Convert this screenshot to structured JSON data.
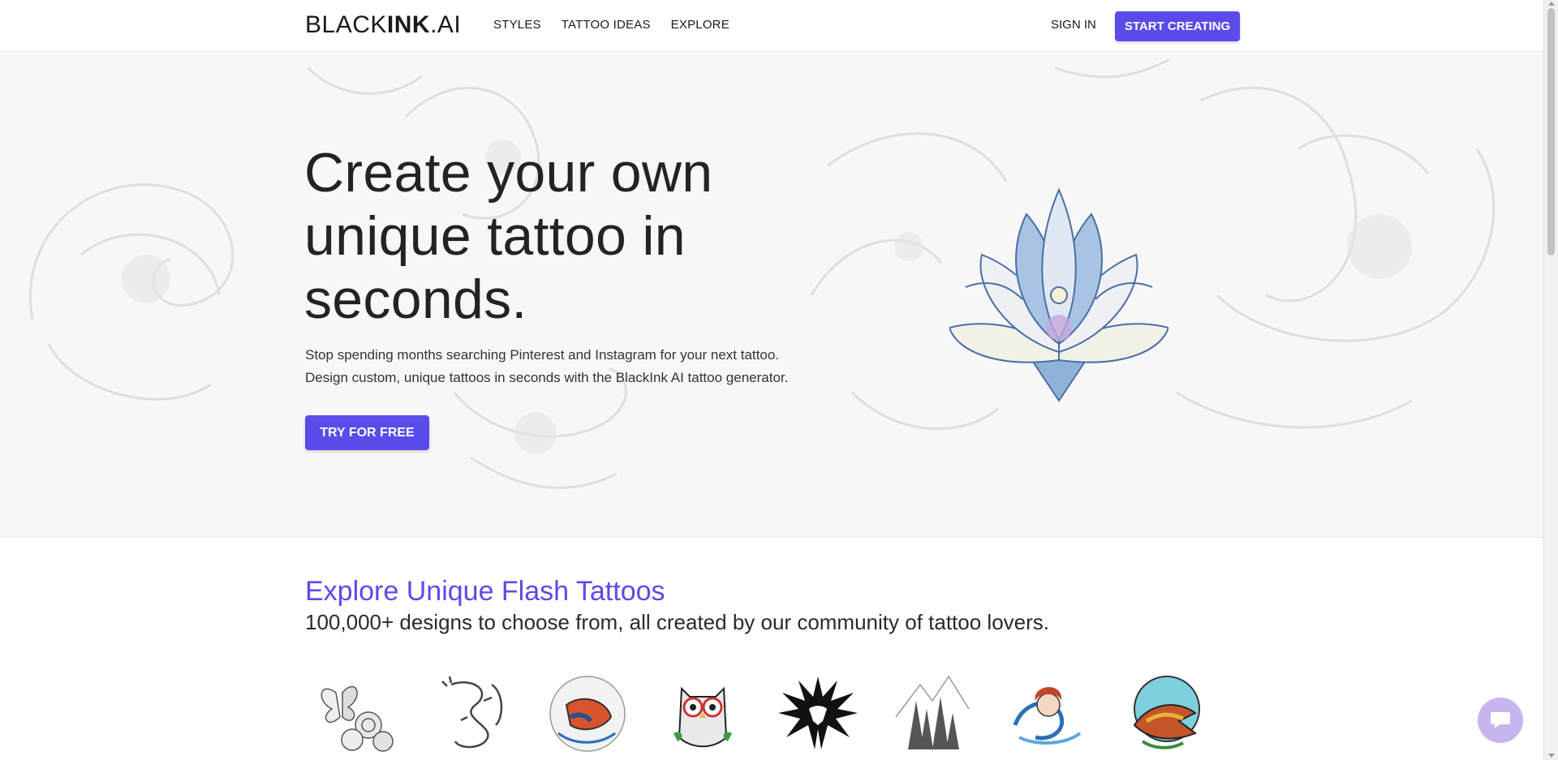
{
  "nav": {
    "logo_left": "BLACK",
    "logo_bold": "INK",
    "logo_right": ".AI",
    "links": [
      "STYLES",
      "TATTOO IDEAS",
      "EXPLORE"
    ],
    "sign_in": "SIGN IN",
    "start_creating": "START CREATING"
  },
  "hero": {
    "title": "Create your own unique tattoo in seconds.",
    "subtitle_line1": "Stop spending months searching Pinterest and Instagram for your next tattoo.",
    "subtitle_line2": "Design custom, unique tattoos in seconds with the BlackInk AI tattoo generator.",
    "cta": "TRY FOR FREE"
  },
  "explore": {
    "title": "Explore Unique Flash Tattoos",
    "subtitle": "100,000+ designs to choose from, all created by our community of tattoo lovers.",
    "items": [
      {
        "icon": "butterfly-roses-tattoo-icon"
      },
      {
        "icon": "dragon-tattoo-icon"
      },
      {
        "icon": "koi-fish-tattoo-icon"
      },
      {
        "icon": "owl-tattoo-icon"
      },
      {
        "icon": "tribal-eagle-tattoo-icon"
      },
      {
        "icon": "forest-mountain-tattoo-icon"
      },
      {
        "icon": "mermaid-wave-tattoo-icon"
      },
      {
        "icon": "swallow-bird-tattoo-icon"
      }
    ]
  },
  "colors": {
    "accent": "#5b4bea",
    "hero_bg": "#f7f7f7",
    "chat_button": "#c7b5ef"
  }
}
